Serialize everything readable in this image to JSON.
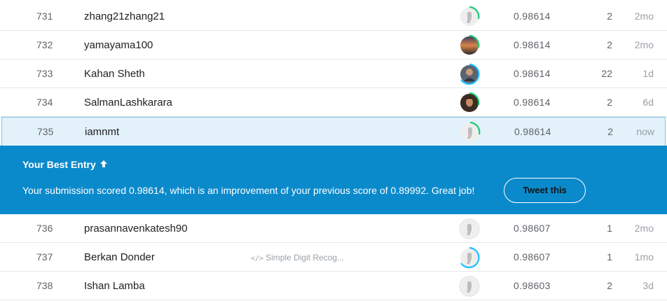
{
  "rows_top": [
    {
      "rank": "731",
      "name": "zhang21zhang21",
      "notebook": "",
      "avatar": "default-avatar",
      "ring": "#20beff",
      "ring_arc": "green",
      "score": "0.98614",
      "entries": "2",
      "last": "2mo"
    },
    {
      "rank": "732",
      "name": "yamayama100",
      "notebook": "",
      "avatar": "sunset-photo",
      "ring": "#20beff",
      "ring_arc": "green",
      "score": "0.98614",
      "entries": "2",
      "last": "2mo"
    },
    {
      "rank": "733",
      "name": "Kahan Sheth",
      "notebook": "",
      "avatar": "person-photo",
      "ring": "#20beff",
      "ring_arc": "blue",
      "score": "0.98614",
      "entries": "22",
      "last": "1d"
    },
    {
      "rank": "734",
      "name": "SalmanLashkarara",
      "notebook": "",
      "avatar": "person-photo",
      "ring": "#20beff",
      "ring_arc": "green",
      "score": "0.98614",
      "entries": "2",
      "last": "6d"
    }
  ],
  "highlight_row": {
    "rank": "735",
    "name": "iamnmt",
    "avatar": "default-avatar",
    "score": "0.98614",
    "entries": "2",
    "last": "now"
  },
  "banner": {
    "title": "Your Best Entry",
    "arrow_icon": "arrow-up-icon",
    "message": "Your submission scored 0.98614, which is an improvement of your previous score of 0.89992. Great job!",
    "tweet_label": "Tweet this"
  },
  "rows_bottom": [
    {
      "rank": "736",
      "name": "prasannavenkatesh90",
      "notebook": "",
      "score": "0.98607",
      "entries": "1",
      "last": "2mo"
    },
    {
      "rank": "737",
      "name": "Berkan Donder",
      "notebook": "Simple Digit Recog...",
      "score": "0.98607",
      "entries": "1",
      "last": "1mo"
    },
    {
      "rank": "738",
      "name": "Ishan Lamba",
      "notebook": "",
      "score": "0.98603",
      "entries": "2",
      "last": "3d"
    }
  ],
  "colors": {
    "banner": "#0b8acb",
    "highlight": "#e3f1fa",
    "ring_green": "#1ec773",
    "ring_blue": "#20beff"
  }
}
